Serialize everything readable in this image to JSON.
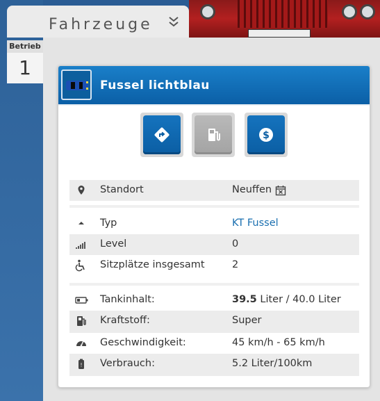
{
  "header": {
    "title": "Fahrzeuge",
    "collapse_icon": "double-chevron-down-icon"
  },
  "sidebar": {
    "label": "Betrieb",
    "number": "1"
  },
  "card": {
    "title": "Fussel lichtblau",
    "vehicle_icon": "car-top-view-icon",
    "vehicle_color": "#1b4fb3",
    "actions": [
      {
        "name": "route",
        "icon": "route-diamond-icon",
        "state": "active"
      },
      {
        "name": "fuel",
        "icon": "fuel-pump-icon",
        "state": "disabled"
      },
      {
        "name": "money",
        "icon": "dollar-coin-icon",
        "state": "active"
      }
    ],
    "location": {
      "label": "Standort",
      "value": "Neuffen",
      "icon": "map-pin-icon",
      "extra_icon": "calendar-x-icon"
    },
    "details": [
      {
        "label": "Typ",
        "value": "KT Fussel",
        "icon": "caret-up-icon"
      },
      {
        "label": "Level",
        "value": "0",
        "icon": "signal-bars-icon"
      },
      {
        "label": "Sitzplätze insgesamt",
        "value": "2",
        "icon": "wheelchair-icon"
      }
    ],
    "fuel": {
      "tank_label": "Tankinhalt:",
      "tank_current": "39.5",
      "tank_rest": " Liter / 40.0 Liter",
      "fuel_label": "Kraftstoff:",
      "fuel_value": "Super",
      "speed_label": "Geschwindigkeit:",
      "speed_value": "45 km/h - 65 km/h",
      "consumption_label": "Verbrauch:",
      "consumption_value": "5.2 Liter/100km"
    }
  },
  "colors": {
    "header_blue": "#0b64ad",
    "link_blue": "#1a6fb0",
    "bg": "#e4e4e4"
  }
}
